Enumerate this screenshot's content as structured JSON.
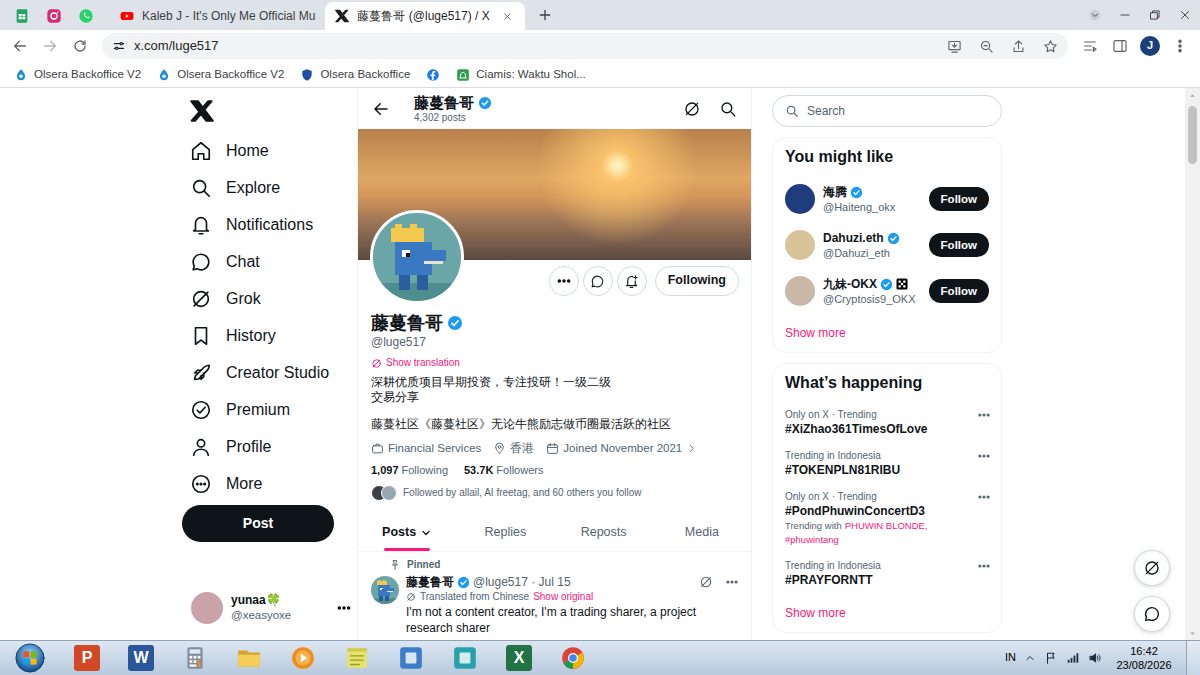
{
  "browser": {
    "tabs": [
      {
        "label": "Kaleb J - It's Only Me Official Mu",
        "selected": false
      },
      {
        "label": "藤蔓鲁哥 (@luge517) / X",
        "selected": true
      }
    ],
    "address": "x.com/luge517",
    "profile_initial": "J",
    "bookmarks": [
      {
        "kind": "text",
        "label": "Olsera Backoffice V2"
      },
      {
        "kind": "text",
        "label": "Olsera Backoffice V2"
      },
      {
        "kind": "text",
        "label": "Olsera Backoffice"
      },
      {
        "kind": "icon"
      },
      {
        "kind": "text",
        "label": "Ciamis: Waktu Shol..."
      }
    ]
  },
  "x": {
    "nav": [
      {
        "label": "Home"
      },
      {
        "label": "Explore"
      },
      {
        "label": "Notifications"
      },
      {
        "label": "Chat"
      },
      {
        "label": "Grok"
      },
      {
        "label": "History"
      },
      {
        "label": "Creator Studio"
      },
      {
        "label": "Premium"
      },
      {
        "label": "Profile"
      },
      {
        "label": "More"
      }
    ],
    "post_button": "Post",
    "account": {
      "name": "yunaa🍀",
      "handle": "@xeasyoxe"
    },
    "header": {
      "name": "藤蔓鲁哥",
      "verified": true,
      "posts": "4,302 posts"
    },
    "profile": {
      "name": "藤蔓鲁哥",
      "verified": true,
      "handle": "@luge517",
      "show_translation": "Show translation",
      "bio_lines": [
        "深耕优质项目早期投资，专注投研！一级二级",
        "交易分享"
      ],
      "community": "藤蔓社区《藤蔓社区》无论牛熊励志做币圈最活跃的社区",
      "category": "Financial Services",
      "location": "香港",
      "joined": "Joined November 2021",
      "following_count": "1,097",
      "following_label": "Following",
      "followers_count": "53.7K",
      "followers_label": "Followers",
      "followed_by": "Followed by allail, AI freetag, and 60 others you follow",
      "follow_button": "Following"
    },
    "tabs": [
      {
        "label": "Posts",
        "selected": true
      },
      {
        "label": "Replies",
        "selected": false
      },
      {
        "label": "Reposts",
        "selected": false
      },
      {
        "label": "Media",
        "selected": false
      }
    ],
    "pinned_post": {
      "label": "Pinned",
      "name": "藤蔓鲁哥",
      "verified": true,
      "meta": "@luge517 · Jul 15",
      "translated": "Translated from Chinese",
      "show_original": "Show original",
      "text": "I'm not a content creator, I'm a trading sharer, a project research sharer"
    },
    "search": {
      "placeholder": "Search"
    },
    "who_to_follow": {
      "title": "You might like",
      "users": [
        {
          "name": "海腾",
          "handle": "@Haiteng_okx",
          "verified": true,
          "affiliate": false,
          "button": "Follow"
        },
        {
          "name": "Dahuzi.eth",
          "handle": "@Dahuzi_eth",
          "verified": true,
          "affiliate": false,
          "button": "Follow"
        },
        {
          "name": "九妹-OKX",
          "handle": "@Cryptosis9_OKX",
          "verified": true,
          "affiliate": true,
          "button": "Follow"
        }
      ],
      "show_more": "Show more"
    },
    "trends": {
      "title": "What’s happening",
      "items": [
        {
          "context": "Only on X · Trending",
          "tag": "#XiZhao361TimesOfLove"
        },
        {
          "context": "Trending in Indonesia",
          "tag": "#TOKENPLN81RIBU"
        },
        {
          "context": "Only on X · Trending",
          "tag": "#PondPhuwinConcertD3",
          "trending_with": {
            "prefix": "Trending with",
            "links": "PHUWIN BLONDE, #phuwintang"
          }
        },
        {
          "context": "Trending in Indonesia",
          "tag": "#PRAYFORNTT"
        }
      ],
      "show_more": "Show more"
    }
  },
  "taskbar": {
    "apps": [
      {
        "kind": "letter",
        "glyph": "P",
        "color": "#d24726"
      },
      {
        "kind": "letter",
        "glyph": "W",
        "color": "#2b579a"
      },
      {
        "kind": "calculator"
      },
      {
        "kind": "folder"
      },
      {
        "kind": "player"
      },
      {
        "kind": "notes"
      },
      {
        "kind": "tile",
        "color": "#3d7cc9"
      },
      {
        "kind": "tile",
        "color": "#2aa0a8"
      },
      {
        "kind": "letter",
        "glyph": "X",
        "color": "#217346"
      },
      {
        "kind": "chrome"
      }
    ],
    "language": "IN",
    "time": "16:42",
    "date": "23/08/2026"
  }
}
